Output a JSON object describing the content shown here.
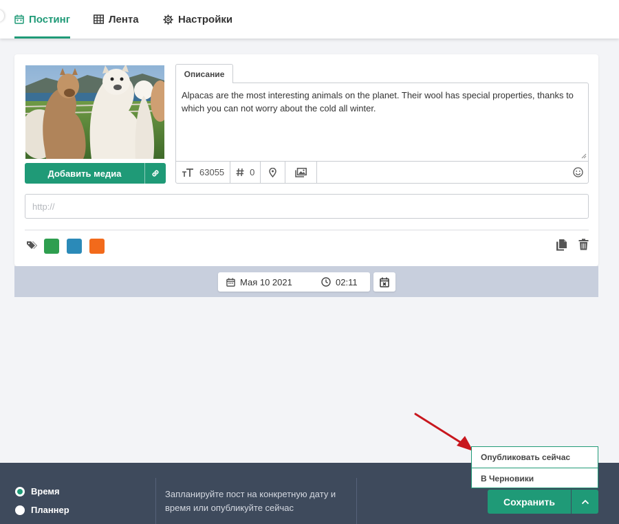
{
  "nav": {
    "tabs": [
      {
        "label": "Постинг",
        "icon": "calendar-icon",
        "active": true
      },
      {
        "label": "Лента",
        "icon": "grid-icon",
        "active": false
      },
      {
        "label": "Настройки",
        "icon": "gear-icon",
        "active": false
      }
    ]
  },
  "post": {
    "add_media_label": "Добавить медиа",
    "description_tab": "Описание",
    "description_text": "Alpacas are the most interesting animals on the planet. Their wool has special properties, thanks to which you can not worry about the cold all winter.",
    "char_count": "63055",
    "hashtag_count": "0",
    "url_placeholder": "http://",
    "tag_colors": [
      "#2e9e4f",
      "#2b8ab8",
      "#f26a1b"
    ]
  },
  "schedule": {
    "date": "Мая 10 2021",
    "time": "02:11"
  },
  "menu": {
    "publish_now": "Опубликовать сейчас",
    "to_drafts": "В Черновики"
  },
  "footer": {
    "radio_time": "Время",
    "radio_planner": "Планнер",
    "hint": "Запланируйте пост на конкретную дату и время или опубликуйте сейчас",
    "save_label": "Сохранить"
  },
  "colors": {
    "accent": "#1f9a77",
    "footer_bg": "#3e4a5c",
    "arrow": "#c8171e"
  }
}
